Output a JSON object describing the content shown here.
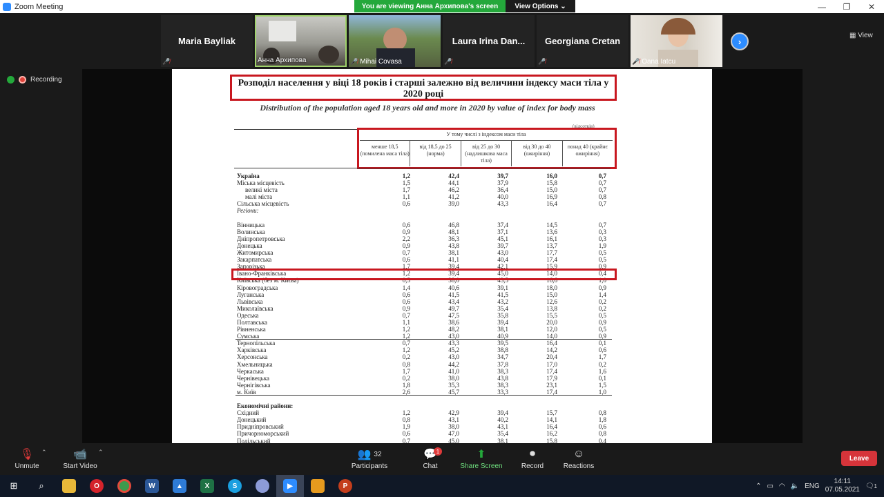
{
  "window": {
    "title": "Zoom Meeting"
  },
  "banner": {
    "text": "You are viewing Анна Архипова's screen",
    "view_options": "View Options ⌄"
  },
  "participants_strip": [
    {
      "name": "Maria Bayliak",
      "video": false
    },
    {
      "name": "Анна Архипова",
      "video": true
    },
    {
      "name": "Mihai Covasa",
      "video": true
    },
    {
      "name": "Laura Irina Dan...",
      "video": false
    },
    {
      "name": "Georgiana Cretan",
      "video": false
    },
    {
      "name": "Oana Iatcu",
      "video": true
    }
  ],
  "view_label": "View",
  "recording_label": "Recording",
  "document": {
    "title": "Розподіл населення у віці 18 років і старші залежно від величини індексу маси тіла у 2020 році",
    "subtitle": "Distribution of the population aged 18 years old and more in 2020 by value of index for body mass",
    "unit_note": "(відсотків)",
    "group_header": "У тому числі з індексом маси тіла",
    "columns": [
      "менше 18,5 (помилена маса тіла)",
      "від 18,5 до 25 (норма)",
      "від 25 до 30 (надлишкова маса тіла)",
      "від 30 до 40 (ожиріння)",
      "понад 40 (крайнє ожиріння)"
    ],
    "rows": [
      {
        "name": "Україна",
        "values": [
          "1,2",
          "42,4",
          "39,7",
          "16,0",
          "0,7"
        ],
        "style": "bold"
      },
      {
        "name": "Міська місцевість",
        "values": [
          "1,5",
          "44,1",
          "37,9",
          "15,8",
          "0,7"
        ]
      },
      {
        "name": "великі міста",
        "values": [
          "1,7",
          "46,2",
          "36,4",
          "15,0",
          "0,7"
        ],
        "style": "indent"
      },
      {
        "name": "малі міста",
        "values": [
          "1,1",
          "41,2",
          "40,0",
          "16,9",
          "0,8"
        ],
        "style": "indent"
      },
      {
        "name": "Сільська місцевість",
        "values": [
          "0,6",
          "39,0",
          "43,3",
          "16,4",
          "0,7"
        ]
      },
      {
        "name": "Регіони:",
        "values": [
          "",
          "",
          "",
          "",
          ""
        ],
        "style": "italic"
      },
      {
        "name": "",
        "values": [
          "",
          "",
          "",
          "",
          ""
        ]
      },
      {
        "name": "Вінницька",
        "values": [
          "0,6",
          "46,8",
          "37,4",
          "14,5",
          "0,7"
        ]
      },
      {
        "name": "Волинська",
        "values": [
          "0,9",
          "48,1",
          "37,1",
          "13,6",
          "0,3"
        ]
      },
      {
        "name": "Дніпропетровська",
        "values": [
          "2,2",
          "36,3",
          "45,1",
          "16,1",
          "0,3"
        ]
      },
      {
        "name": "Донецька",
        "values": [
          "0,9",
          "43,8",
          "39,7",
          "13,7",
          "1,9"
        ]
      },
      {
        "name": "Житомирська",
        "values": [
          "0,7",
          "38,1",
          "43,0",
          "17,7",
          "0,5"
        ]
      },
      {
        "name": "Закарпатська",
        "values": [
          "0,6",
          "41,1",
          "40,4",
          "17,4",
          "0,5"
        ]
      },
      {
        "name": "Запорізька",
        "values": [
          "1,7",
          "39,4",
          "42,1",
          "15,9",
          "0,9"
        ]
      },
      {
        "name": "Івано-Франківська",
        "values": [
          "1,2",
          "39,4",
          "45,0",
          "14,0",
          "0,4"
        ],
        "style": "highlight"
      },
      {
        "name": "Київська (без м. Києва)",
        "values": [
          "0,5",
          "38,0",
          "43,5",
          "16,6",
          "1,0"
        ]
      },
      {
        "name": "Кіровоградська",
        "values": [
          "1,4",
          "40,6",
          "39,1",
          "18,0",
          "0,9"
        ]
      },
      {
        "name": "Луганська",
        "values": [
          "0,6",
          "41,5",
          "41,5",
          "15,0",
          "1,4"
        ]
      },
      {
        "name": "Львівська",
        "values": [
          "0,6",
          "43,4",
          "43,2",
          "12,6",
          "0,2"
        ]
      },
      {
        "name": "Миколаївська",
        "values": [
          "0,9",
          "49,7",
          "35,4",
          "13,8",
          "0,2"
        ]
      },
      {
        "name": "Одеська",
        "values": [
          "0,7",
          "47,5",
          "35,8",
          "15,5",
          "0,5"
        ]
      },
      {
        "name": "Полтавська",
        "values": [
          "1,1",
          "38,6",
          "39,4",
          "20,0",
          "0,9"
        ]
      },
      {
        "name": "Рівненська",
        "values": [
          "1,2",
          "48,2",
          "38,1",
          "12,0",
          "0,5"
        ]
      },
      {
        "name": "Сумська",
        "values": [
          "1,2",
          "43,0",
          "40,9",
          "14,0",
          "0,9"
        ],
        "style": "underline"
      },
      {
        "name": "Тернопільська",
        "values": [
          "0,7",
          "43,3",
          "39,5",
          "16,4",
          "0,1"
        ]
      },
      {
        "name": "Харківська",
        "values": [
          "1,2",
          "45,2",
          "38,8",
          "14,2",
          "0,6"
        ]
      },
      {
        "name": "Херсонська",
        "values": [
          "0,2",
          "43,0",
          "34,7",
          "20,4",
          "1,7"
        ]
      },
      {
        "name": "Хмельницька",
        "values": [
          "0,8",
          "44,2",
          "37,8",
          "17,0",
          "0,2"
        ]
      },
      {
        "name": "Черкаська",
        "values": [
          "1,7",
          "41,0",
          "38,3",
          "17,4",
          "1,6"
        ]
      },
      {
        "name": "Чернівецька",
        "values": [
          "0,2",
          "38,0",
          "43,8",
          "17,9",
          "0,1"
        ]
      },
      {
        "name": "Чернігівська",
        "values": [
          "1,8",
          "35,3",
          "38,3",
          "23,1",
          "1,5"
        ]
      },
      {
        "name": "м. Київ",
        "values": [
          "2,6",
          "45,7",
          "33,3",
          "17,4",
          "1,0"
        ],
        "style": "underline"
      },
      {
        "name": "",
        "values": [
          "",
          "",
          "",
          "",
          ""
        ]
      },
      {
        "name": "Економічні райони:",
        "values": [
          "",
          "",
          "",
          "",
          ""
        ],
        "style": "bold"
      },
      {
        "name": "Східний",
        "values": [
          "1,2",
          "42,9",
          "39,4",
          "15,7",
          "0,8"
        ]
      },
      {
        "name": "Донецький",
        "values": [
          "0,8",
          "43,1",
          "40,2",
          "14,1",
          "1,8"
        ]
      },
      {
        "name": "Придніпровський",
        "values": [
          "1,9",
          "38,0",
          "43,1",
          "16,4",
          "0,6"
        ]
      },
      {
        "name": "Причорноморський",
        "values": [
          "0,6",
          "47,0",
          "35,4",
          "16,2",
          "0,8"
        ]
      },
      {
        "name": "Подільський",
        "values": [
          "0,7",
          "45,0",
          "38,1",
          "15,8",
          "0,4"
        ]
      }
    ]
  },
  "toolbar": {
    "unmute": "Unmute",
    "start_video": "Start Video",
    "participants": "Participants",
    "participants_count": "32",
    "chat": "Chat",
    "chat_badge": "1",
    "share_screen": "Share Screen",
    "record": "Record",
    "reactions": "Reactions",
    "leave": "Leave"
  },
  "taskbar": {
    "language": "ENG",
    "time": "14:11",
    "date": "07.05.2021",
    "notification_count": "1"
  }
}
